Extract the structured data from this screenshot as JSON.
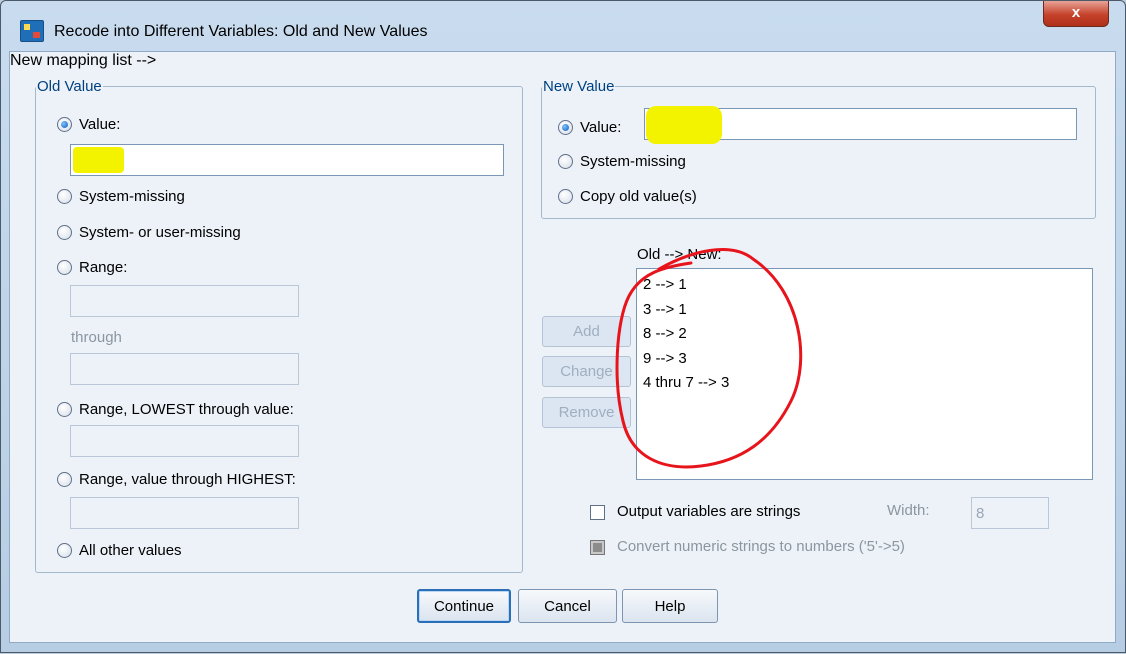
{
  "window": {
    "title": "Recode into Different Variables: Old and New Values",
    "close_label": "x"
  },
  "old_value": {
    "legend": "Old Value",
    "value_label": "Value:",
    "value_input": "",
    "system_missing_label": "System-missing",
    "system_or_user_missing_label": "System- or user-missing",
    "range_label": "Range:",
    "through_label": "through",
    "range_lowest_label": "Range, LOWEST through value:",
    "range_highest_label": "Range, value through HIGHEST:",
    "all_other_label": "All other values",
    "selected": "value"
  },
  "new_value": {
    "legend": "New Value",
    "value_label": "Value:",
    "value_input": "",
    "system_missing_label": "System-missing",
    "copy_old_label": "Copy old value(s)",
    "selected": "value"
  },
  "mapping": {
    "header": "Old --> New:",
    "items": [
      "2 --> 1",
      "3 --> 1",
      "8 --> 2",
      "9 --> 3",
      "4 thru 7 --> 3"
    ]
  },
  "buttons": {
    "add": "Add",
    "change": "Change",
    "remove": "Remove",
    "continue": "Continue",
    "cancel": "Cancel",
    "help": "Help"
  },
  "output": {
    "strings_label": "Output variables are strings",
    "width_label": "Width:",
    "width_value": "8",
    "convert_label": "Convert numeric strings to numbers ('5'->5)"
  },
  "colors": {
    "highlight": "#f3f300",
    "annotation": "#e8141c",
    "accent": "#2b6fb9"
  }
}
